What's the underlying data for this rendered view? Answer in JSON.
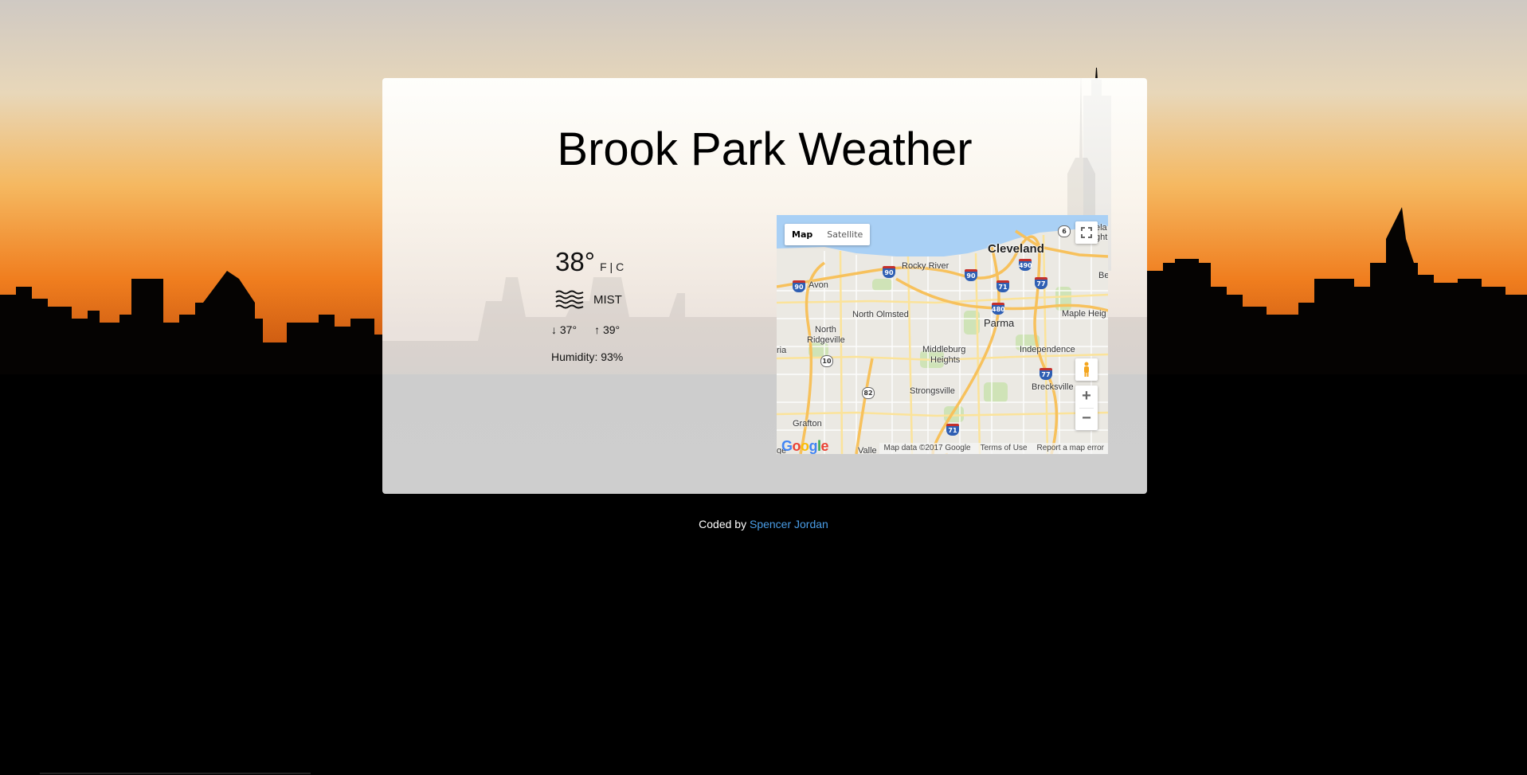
{
  "page": {
    "title": "Brook Park Weather"
  },
  "weather": {
    "temperature": "38°",
    "unit_f": "F",
    "unit_separator": " | ",
    "unit_c": "C",
    "condition_icon": "mist-icon",
    "condition": "MIST",
    "min_temp": "↓ 37°",
    "max_temp": "↑ 39°",
    "humidity": "Humidity: 93%"
  },
  "map": {
    "type_map": "Map",
    "type_satellite": "Satellite",
    "places": {
      "cleveland": "Cleveland",
      "rocky_river": "Rocky River",
      "avon": "Avon",
      "north_olmsted": "North Olmsted",
      "parma": "Parma",
      "maple_heights": "Maple Heig",
      "north_ridgeville_1": "North",
      "north_ridgeville_2": "Ridgeville",
      "middleburg_1": "Middleburg",
      "middleburg_2": "Heights",
      "independence": "Independence",
      "brecksville": "Brecksville",
      "strongsville": "Strongsville",
      "grafton": "Grafton",
      "valley": "Valle",
      "ria": "ria",
      "ge": "ge",
      "be": "Be",
      "cleveland_hts_1": "ela",
      "cleveland_hts_2": "ght"
    },
    "shields": {
      "i90_a": "90",
      "i90_b": "90",
      "i90_c": "90",
      "i71_a": "71",
      "i71_b": "71",
      "i490": "490",
      "i77_a": "77",
      "i77_b": "77",
      "i480": "480",
      "us6": "6",
      "sr10": "10",
      "sr82": "82"
    },
    "logo": "Google",
    "attribution": "Map data ©2017 Google",
    "terms": "Terms of Use",
    "report": "Report a map error",
    "zoom_in": "+",
    "zoom_out": "−"
  },
  "footer": {
    "prefix": "Coded by ",
    "author": "Spencer Jordan"
  },
  "colors": {
    "link": "#4a9de6",
    "water": "#a9d0f5",
    "highway": "#f7c15c"
  }
}
